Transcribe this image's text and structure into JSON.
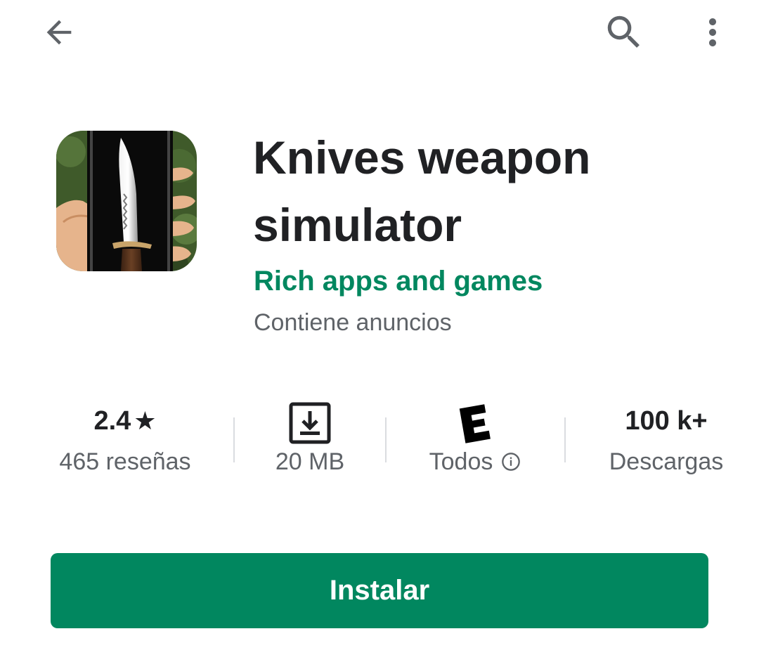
{
  "toolbar": {
    "back_icon": "arrow-back-icon",
    "search_icon": "search-icon",
    "more_icon": "more-vert-icon"
  },
  "app": {
    "title": "Knives weapon simulator",
    "developer": "Rich apps and games",
    "ads_note": "Contiene anuncios",
    "icon": "knife-app-icon"
  },
  "stats": {
    "rating": {
      "value": "2.4",
      "star": "★",
      "label": "465 reseñas"
    },
    "size": {
      "icon": "download-icon",
      "label": "20 MB"
    },
    "content_rating": {
      "badge": "E",
      "label": "Todos",
      "info_icon": "info-icon"
    },
    "downloads": {
      "value": "100 k+",
      "label": "Descargas"
    }
  },
  "install": {
    "label": "Instalar"
  },
  "colors": {
    "accent": "#01875f",
    "text_primary": "#202124",
    "text_secondary": "#5f6368",
    "divider": "#dadce0"
  }
}
